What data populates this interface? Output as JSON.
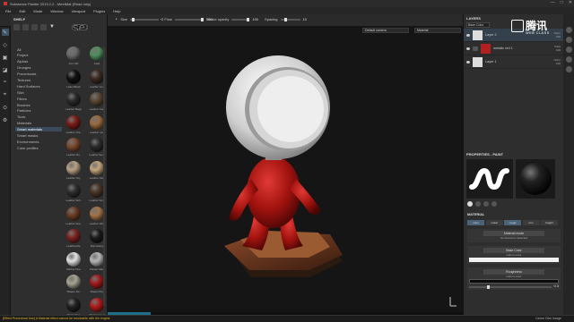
{
  "app": {
    "title": "Substance Painter 2019.2.2 - MeetMat (Read only)",
    "window_buttons": [
      "—",
      "□",
      "✕"
    ]
  },
  "menu": [
    "File",
    "Edit",
    "Mode",
    "Window",
    "Viewport",
    "Plugins",
    "Help"
  ],
  "toolbar": {
    "size_label": "Size",
    "size_value": "2",
    "flow_label": "Flow",
    "flow_value": "100",
    "stroke_opacity_label": "Stroke opacity",
    "stroke_opacity_value": "100",
    "spacing_label": "Spacing",
    "spacing_value": "10"
  },
  "shelf": {
    "title": "SHELF",
    "search_placeholder": "search",
    "categories": [
      "All",
      "Project",
      "Alphas",
      "Grunges",
      "Procedurals",
      "Textures",
      "Hard Surfaces",
      "Skin",
      "Filters",
      "Brushes",
      "Particles",
      "Tools",
      "Materials",
      "Smart materials",
      "Smart masks",
      "Environments",
      "Color profiles"
    ],
    "selected_category": "Smart materials",
    "materials": [
      {
        "label": "Iron Old",
        "color": "#6b6b6b"
      },
      {
        "label": "Jade",
        "color": "#4f8f5b"
      },
      {
        "label": "Latex Black",
        "color": "#111111"
      },
      {
        "label": "Leather Coll",
        "color": "#3b2a22"
      },
      {
        "label": "Leather Bags",
        "color": "#2a2a2a"
      },
      {
        "label": "Leather Sur.",
        "color": "#5a4634"
      },
      {
        "label": "Leather Ore.",
        "color": "#7c1c16"
      },
      {
        "label": "Leather Lin.",
        "color": "#9b6a3c"
      },
      {
        "label": "Leather Ro.",
        "color": "#7a4a2c"
      },
      {
        "label": "Leather Sea.",
        "color": "#2b2b2b"
      },
      {
        "label": "Leather Sty.",
        "color": "#b9a184"
      },
      {
        "label": "Leather Sto.",
        "color": "#c2a57a"
      },
      {
        "label": "Leather Sch.",
        "color": "#2e2e2e"
      },
      {
        "label": "Leather Sco.",
        "color": "#4a3526"
      },
      {
        "label": "Leather Sup.",
        "color": "#6b3c22"
      },
      {
        "label": "Leather Wo.",
        "color": "#a47347"
      },
      {
        "label": "Leatherette",
        "color": "#7a2320"
      },
      {
        "label": "Mat Heavy",
        "color": "#1b1b1b"
      },
      {
        "label": "Marble Fine",
        "color": "#e3e3e3"
      },
      {
        "label": "Plaster Mar.",
        "color": "#b7b7b7"
      },
      {
        "label": "Plaster Ro.",
        "color": "#a6a38f"
      },
      {
        "label": "Plastic Pla.",
        "color": "#a11b1b"
      },
      {
        "label": "Plastic Pol.",
        "color": "#202020"
      },
      {
        "label": "Plastic sea 2",
        "color": "#b01a1a"
      }
    ]
  },
  "viewport": {
    "camera_label": "Default camera",
    "mode_label": "Material"
  },
  "layers": {
    "title": "LAYERS",
    "blend_dropdown": "Base Color",
    "rows": [
      {
        "name": "Layer 2",
        "blend": "Norm",
        "opacity": "100",
        "type": "paint",
        "selected": true
      },
      {
        "name": "metalic red 1",
        "blend": "Pass",
        "opacity": "100",
        "type": "folder",
        "selected": false
      },
      {
        "name": "Layer 1",
        "blend": "Norm",
        "opacity": "100",
        "type": "paint",
        "selected": false
      }
    ]
  },
  "properties": {
    "title": "PROPERTIES - PAINT",
    "material_title": "MATERIAL",
    "channels": [
      "color",
      "metal",
      "rough",
      "nrm",
      "height"
    ],
    "active_channels": [
      "color",
      "rough"
    ],
    "material_mode": {
      "header": "Material mode",
      "sub": "No Resource Selected"
    },
    "base_color": {
      "header": "Base Color",
      "sub": "uniform color"
    },
    "roughness": {
      "header": "Roughness",
      "sub": "uniform color",
      "value": "0.3"
    }
  },
  "statusbar": {
    "warning": "[Effect Procedural Use] A Material effect cannot be resolvable with the engine",
    "cache_label": "Cache Disk Usage"
  },
  "watermark": {
    "main": "腾讯",
    "sub": "WEB CLASS"
  }
}
